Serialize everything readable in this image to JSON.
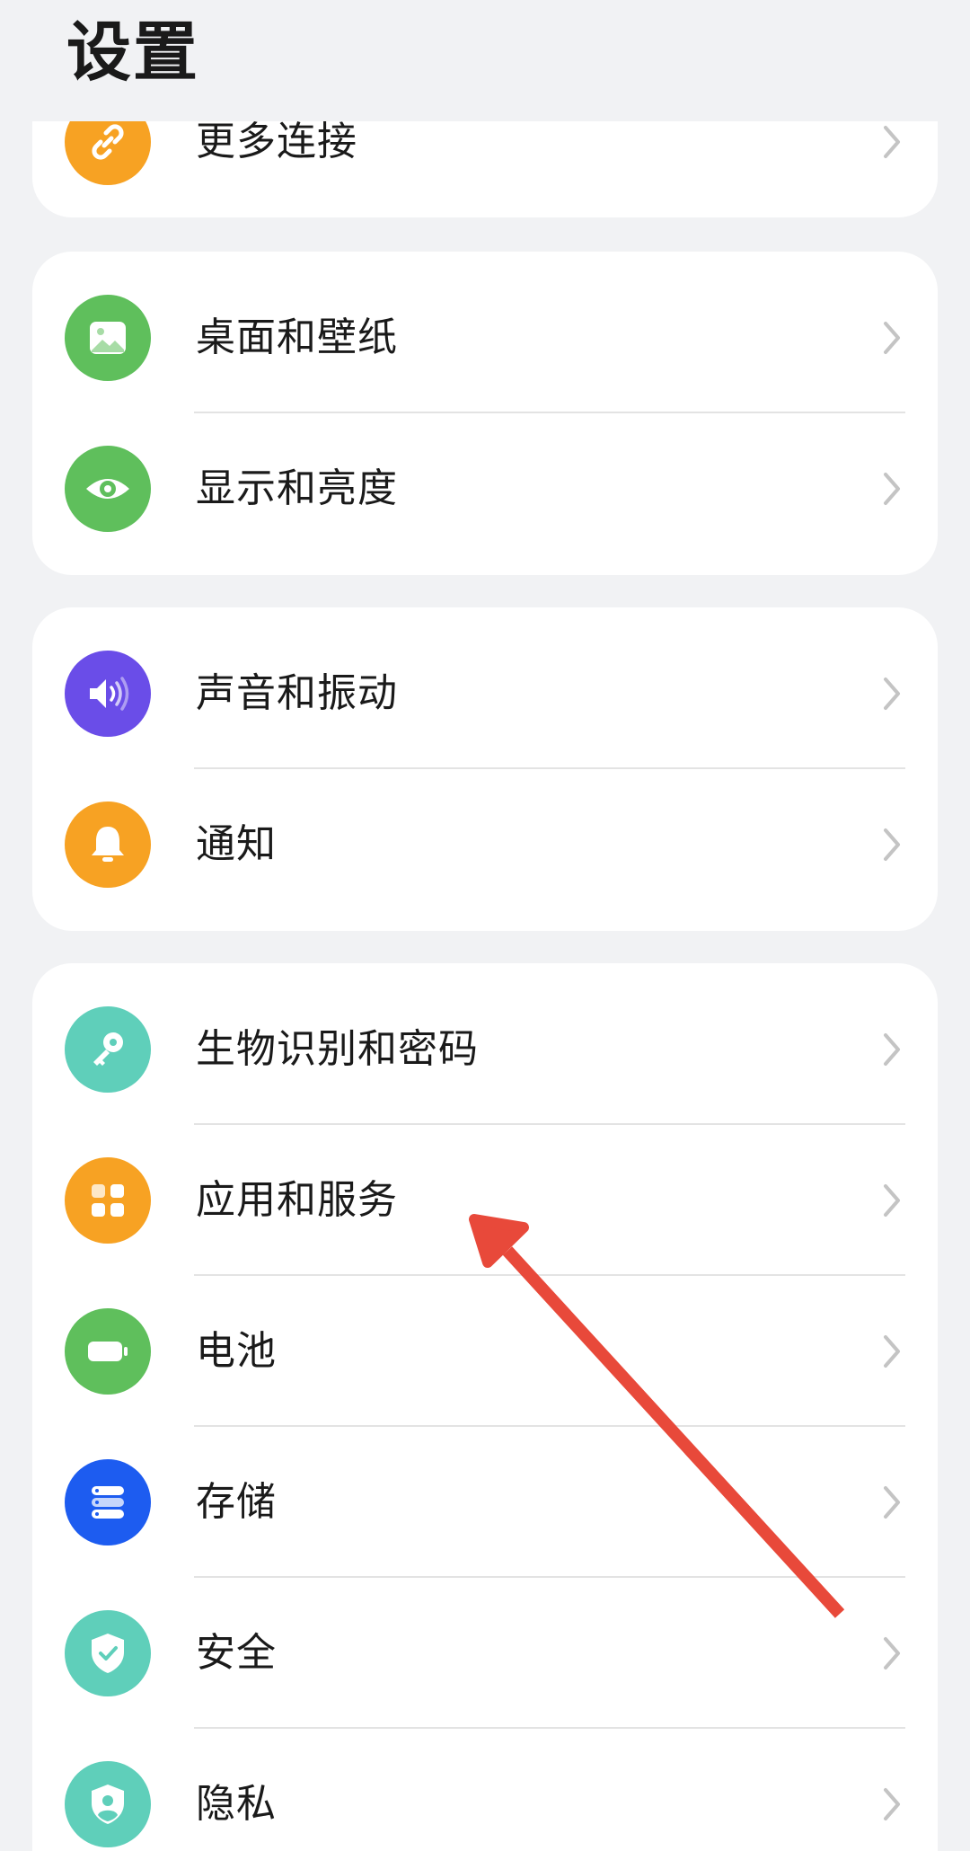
{
  "header": {
    "title": "设置"
  },
  "groups": [
    {
      "items": [
        {
          "label": "更多连接",
          "icon": "link-icon",
          "color": "#f7a223"
        }
      ]
    },
    {
      "items": [
        {
          "label": "桌面和壁纸",
          "icon": "wallpaper-icon",
          "color": "#5fbf5c"
        },
        {
          "label": "显示和亮度",
          "icon": "eye-icon",
          "color": "#5fbf5c"
        }
      ]
    },
    {
      "items": [
        {
          "label": "声音和振动",
          "icon": "speaker-icon",
          "color": "#6a4de8"
        },
        {
          "label": "通知",
          "icon": "bell-icon",
          "color": "#f7a223"
        }
      ]
    },
    {
      "items": [
        {
          "label": "生物识别和密码",
          "icon": "key-icon",
          "color": "#5fcfba"
        },
        {
          "label": "应用和服务",
          "icon": "apps-grid-icon",
          "color": "#f7a223"
        },
        {
          "label": "电池",
          "icon": "battery-icon",
          "color": "#5fbf5c"
        },
        {
          "label": "存储",
          "icon": "storage-icon",
          "color": "#1d5cf0"
        },
        {
          "label": "安全",
          "icon": "shield-check-icon",
          "color": "#5fcfba"
        },
        {
          "label": "隐私",
          "icon": "privacy-shield-icon",
          "color": "#5fcfba"
        }
      ]
    }
  ],
  "annotation": {
    "arrow_color": "#e8493a"
  }
}
